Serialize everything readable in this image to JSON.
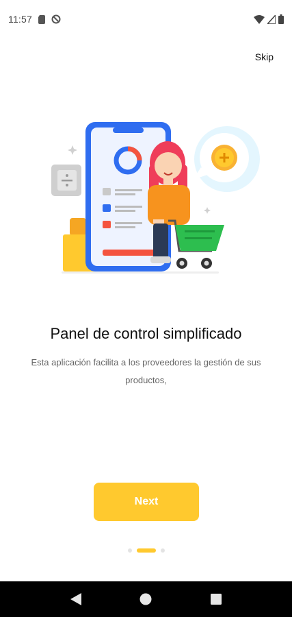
{
  "status_bar": {
    "time": "11:57",
    "icons_left": [
      "sim-card-icon",
      "no-disturb-icon"
    ],
    "icons_right": [
      "wifi-icon",
      "signal-icon",
      "battery-icon"
    ]
  },
  "onboarding": {
    "skip_label": "Skip",
    "title": "Panel de control simplificado",
    "subtitle": "Esta aplicación facilita a los proveedores la gestión de sus productos,",
    "next_label": "Next",
    "page_count": 3,
    "current_page": 2
  },
  "navigation": {
    "buttons": [
      "back-icon",
      "home-icon",
      "recents-icon"
    ]
  },
  "colors": {
    "accent": "#FFC92E",
    "phone_blue": "#2F6DF0",
    "cart_green": "#2DBE4F",
    "character_orange": "#F7931E",
    "character_hair": "#EF3D5A"
  }
}
